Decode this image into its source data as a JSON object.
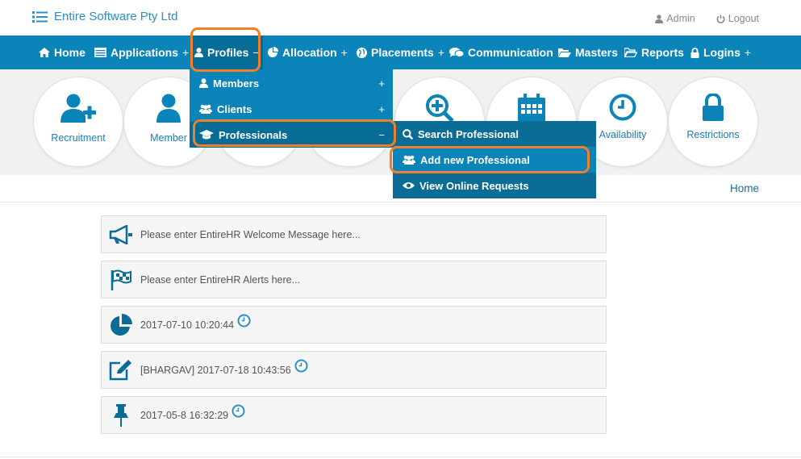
{
  "brand": {
    "name": "Entire Software Pty Ltd"
  },
  "user": {
    "admin_label": "Admin",
    "logout_label": "Logout"
  },
  "nav": {
    "home": "Home",
    "applications": "Applications",
    "profiles": "Profiles",
    "allocation": "Allocation",
    "placements": "Placements",
    "communication": "Communication",
    "masters": "Masters",
    "reports": "Reports",
    "logins": "Logins",
    "plus": "+",
    "minus": "−"
  },
  "hero": [
    {
      "label": "Recruitment",
      "icon": "user-plus-icon"
    },
    {
      "label": "Member",
      "icon": "user-icon"
    },
    {
      "label": "",
      "icon": "search-plus-icon"
    },
    {
      "label": "",
      "icon": "calendar-icon"
    },
    {
      "label": "Availability",
      "icon": "clock-icon"
    },
    {
      "label": "Restrictions",
      "icon": "lock-icon"
    }
  ],
  "profiles_menu": {
    "members": "Members",
    "clients": "Clients",
    "professionals": "Professionals"
  },
  "professionals_menu": {
    "search": "Search Professional",
    "add": "Add new Professional",
    "online": "View Online Requests"
  },
  "breadcrumb": {
    "home": "Home"
  },
  "panels": [
    {
      "icon": "megaphone-icon",
      "text": "Please enter EntireHR Welcome Message here..."
    },
    {
      "icon": "flag-icon",
      "text": "Please enter EntireHR Alerts here..."
    },
    {
      "icon": "pie-chart-icon",
      "text": "2017-07-10 10:20:44"
    },
    {
      "icon": "edit-icon",
      "text": "[BHARGAV] 2017-07-18 10:43:56"
    },
    {
      "icon": "pin-icon",
      "text": "2017-05-8 16:32:29"
    }
  ],
  "colors": {
    "nav_bg": "#0b84b9",
    "nav_active": "#066c98",
    "annotation": "#f07f2a",
    "accent": "#1b7fb3"
  }
}
